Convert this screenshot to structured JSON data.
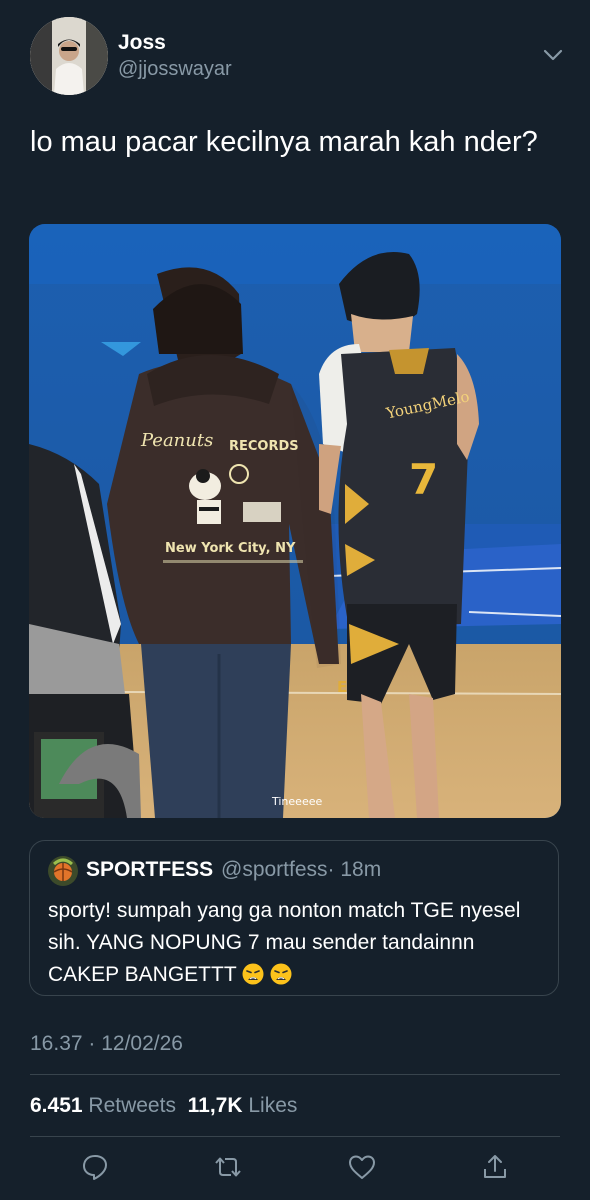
{
  "header": {
    "display_name": "Joss",
    "handle": "@jjosswayar"
  },
  "tweet": {
    "text": "lo mau pacar kecilnya marah kah nder?",
    "media_watermark": "Tineeeee"
  },
  "media_scene": {
    "hoodie_print_line1": "Peanuts RECORDS",
    "hoodie_print_line2": "New York City, NY",
    "jersey_name": "YoungMelo",
    "jersey_number": "7"
  },
  "quote": {
    "display_name": "SPORTFESS",
    "handle": "@sportfess",
    "time": "· 18m",
    "text_main": "sporty! sumpah yang ga nonton match TGE nyesel sih. YANG NOPUNG 7 mau sender tandainnn CAKEP BANGETTT",
    "emoji_name": "weary-face-emoji"
  },
  "meta": {
    "timestamp": "16.37 · 12/02/26",
    "retweets_count": "6.451",
    "retweets_label": "Retweets",
    "likes_count": "11,7K",
    "likes_label": "Likes"
  },
  "actions": {
    "reply_icon": "reply-icon",
    "retweet_icon": "retweet-icon",
    "like_icon": "like-icon",
    "share_icon": "share-icon"
  },
  "colors": {
    "background": "#15202b",
    "secondary_text": "#8899a6",
    "border": "#38444d"
  }
}
